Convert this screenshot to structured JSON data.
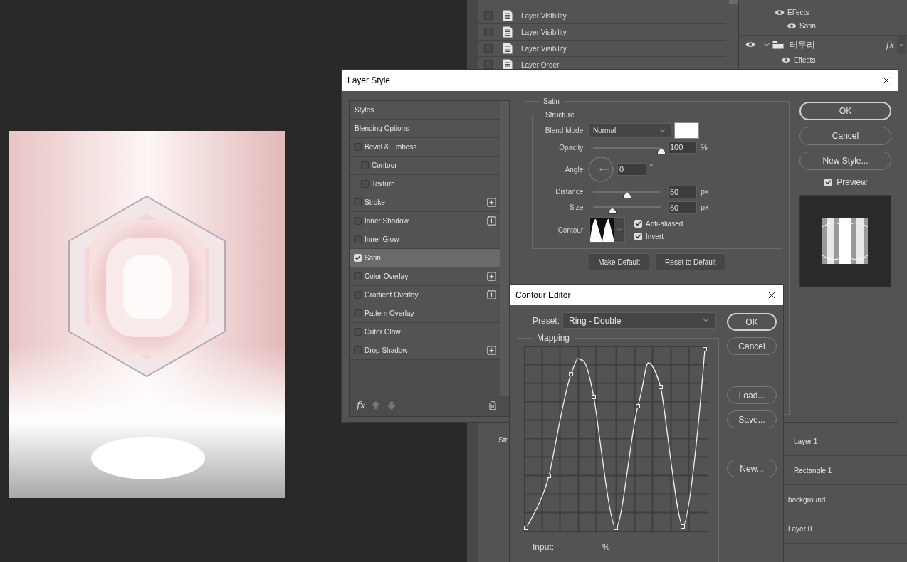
{
  "history_panel": {
    "items": [
      {
        "label": "Layer Visibility",
        "checked": false
      },
      {
        "label": "Layer Visibility",
        "checked": false
      },
      {
        "label": "Layer Visibility",
        "checked": false
      },
      {
        "label": "Layer Order",
        "checked": false
      }
    ]
  },
  "side_panel": {
    "label": "Str"
  },
  "layers_panel": {
    "top_items": [
      {
        "kind": "effects",
        "label": "Effects",
        "visible": true
      },
      {
        "kind": "effect",
        "label": "Satin",
        "visible": true
      },
      {
        "kind": "group",
        "label": "테두리",
        "visible": true,
        "expanded": true,
        "badge": "fx"
      },
      {
        "kind": "effects",
        "label": "Effects",
        "visible": true
      }
    ],
    "bottom_items": [
      {
        "label": "Layer 1"
      },
      {
        "label": "Rectangle 1"
      },
      {
        "label": "background"
      },
      {
        "label": "Layer 0"
      }
    ]
  },
  "layer_style": {
    "title": "Layer Style",
    "styles": [
      {
        "kind": "header",
        "label": "Styles",
        "selected": false
      },
      {
        "kind": "header",
        "label": "Blending Options",
        "selected": false
      },
      {
        "kind": "effect",
        "label": "Bevel & Emboss",
        "checked": false,
        "selected": false,
        "add": false,
        "children": [
          {
            "kind": "effect",
            "label": "Contour",
            "checked": false,
            "selected": false,
            "add": false
          },
          {
            "kind": "effect",
            "label": "Texture",
            "checked": false,
            "selected": false,
            "add": false
          }
        ]
      },
      {
        "kind": "effect",
        "label": "Stroke",
        "checked": false,
        "selected": false,
        "add": true
      },
      {
        "kind": "effect",
        "label": "Inner Shadow",
        "checked": false,
        "selected": false,
        "add": true
      },
      {
        "kind": "effect",
        "label": "Inner Glow",
        "checked": false,
        "selected": false,
        "add": false
      },
      {
        "kind": "effect",
        "label": "Satin",
        "checked": true,
        "selected": true,
        "add": false
      },
      {
        "kind": "effect",
        "label": "Color Overlay",
        "checked": false,
        "selected": false,
        "add": true
      },
      {
        "kind": "effect",
        "label": "Gradient Overlay",
        "checked": false,
        "selected": false,
        "add": true
      },
      {
        "kind": "effect",
        "label": "Pattern Overlay",
        "checked": false,
        "selected": false,
        "add": false
      },
      {
        "kind": "effect",
        "label": "Outer Glow",
        "checked": false,
        "selected": false,
        "add": false
      },
      {
        "kind": "effect",
        "label": "Drop Shadow",
        "checked": false,
        "selected": false,
        "add": true
      }
    ],
    "footer": {
      "fx": "fx"
    },
    "satin": {
      "title": "Satin",
      "structure": {
        "title": "Structure",
        "blend_mode": {
          "label": "Blend Mode:",
          "value": "Normal",
          "color": "#ffffff"
        },
        "opacity": {
          "label": "Opacity:",
          "level": 1,
          "value": "100",
          "unit": "%"
        },
        "angle": {
          "label": "Angle:",
          "value": "0",
          "unit": "°"
        },
        "distance": {
          "label": "Distance:",
          "level": 0.5,
          "value": "50",
          "unit": "px"
        },
        "size": {
          "label": "Size:",
          "level": 0.28,
          "value": "60",
          "unit": "px"
        },
        "contour": {
          "label": "Contour:"
        },
        "anti_aliased": {
          "label": "Anti-aliased",
          "checked": true
        },
        "invert": {
          "label": "Invert",
          "checked": true
        }
      },
      "buttons": [
        "Make Default",
        "Reset to Default"
      ]
    },
    "actions": [
      {
        "label": "OK",
        "kind": "default"
      },
      {
        "label": "Cancel",
        "kind": "normal"
      },
      {
        "label": "New Style...",
        "kind": "normal"
      }
    ],
    "preview": {
      "label": "Preview",
      "checked": true
    }
  },
  "contour_editor": {
    "title": "Contour Editor",
    "preset": {
      "label": "Preset:",
      "value": "Ring - Double"
    },
    "mapping": {
      "title": "Mapping"
    },
    "input": {
      "label": "Input:",
      "unit": "%"
    },
    "button_groups": [
      [
        {
          "label": "OK",
          "kind": "default"
        },
        {
          "label": "Cancel",
          "kind": "normal"
        }
      ],
      [
        {
          "label": "Load...",
          "kind": "normal"
        },
        {
          "label": "Save...",
          "kind": "normal"
        }
      ],
      [
        {
          "label": "New...",
          "kind": "normal"
        }
      ]
    ]
  }
}
